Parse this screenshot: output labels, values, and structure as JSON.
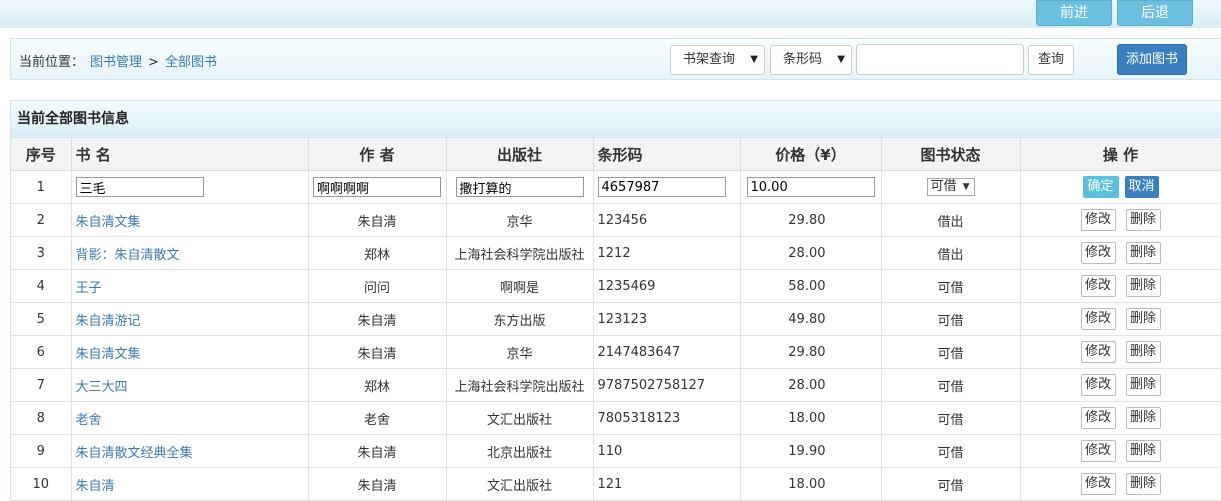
{
  "topnav": {
    "forward": "前进",
    "back": "后退"
  },
  "location": {
    "label": "当前位置：",
    "crumb1": "图书管理",
    "sep": ">",
    "crumb2": "全部图书"
  },
  "search": {
    "shelf_select": "书架查询",
    "field_select": "条形码",
    "input_value": "",
    "query_button": "查询",
    "add_button": "添加图书"
  },
  "panel": {
    "title": "当前全部图书信息"
  },
  "table": {
    "headers": [
      "序号",
      "书 名",
      "作 者",
      "出版社",
      "条形码",
      "价格（¥）",
      "图书状态",
      "操 作"
    ],
    "edit_row": {
      "index": "1",
      "title": "三毛",
      "author": "啊啊啊啊",
      "publisher": "撒打算的",
      "barcode": "4657987",
      "price": "10.00",
      "status": "可借",
      "confirm": "确定",
      "cancel": "取消"
    },
    "rows": [
      {
        "index": "2",
        "title": "朱自清文集",
        "author": "朱自清",
        "publisher": "京华",
        "barcode": "123456",
        "price": "29.80",
        "status": "借出"
      },
      {
        "index": "3",
        "title": "背影：朱自清散文",
        "author": "郑林",
        "publisher": "上海社会科学院出版社",
        "barcode": "1212",
        "price": "28.00",
        "status": "借出"
      },
      {
        "index": "4",
        "title": "王子",
        "author": "问问",
        "publisher": "啊啊是",
        "barcode": "1235469",
        "price": "58.00",
        "status": "可借"
      },
      {
        "index": "5",
        "title": "朱自清游记",
        "author": "朱自清",
        "publisher": "东方出版",
        "barcode": "123123",
        "price": "49.80",
        "status": "可借"
      },
      {
        "index": "6",
        "title": "朱自清文集",
        "author": "朱自清",
        "publisher": "京华",
        "barcode": "2147483647",
        "price": "29.80",
        "status": "可借"
      },
      {
        "index": "7",
        "title": "大三大四",
        "author": "郑林",
        "publisher": "上海社会科学院出版社",
        "barcode": "9787502758127",
        "price": "28.00",
        "status": "可借"
      },
      {
        "index": "8",
        "title": "老舍",
        "author": "老舍",
        "publisher": "文汇出版社",
        "barcode": "7805318123",
        "price": "18.00",
        "status": "可借"
      },
      {
        "index": "9",
        "title": "朱自清散文经典全集",
        "author": "朱自清",
        "publisher": "北京出版社",
        "barcode": "110",
        "price": "19.90",
        "status": "可借"
      },
      {
        "index": "10",
        "title": "朱自清",
        "author": "朱自清",
        "publisher": "文汇出版社",
        "barcode": "121",
        "price": "18.00",
        "status": "可借"
      }
    ],
    "edit_label": "修改",
    "delete_label": "删除"
  }
}
